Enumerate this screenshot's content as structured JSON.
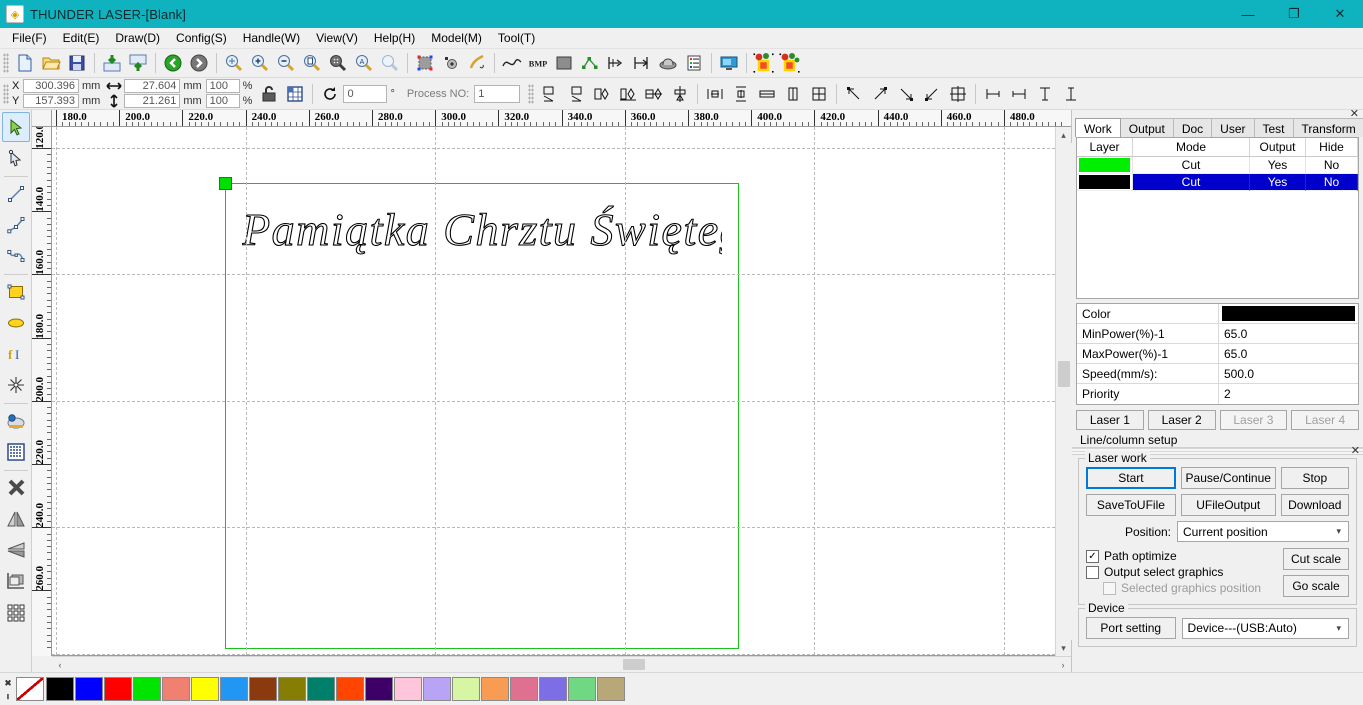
{
  "window": {
    "title": "THUNDER LASER-[Blank]",
    "app_icon": "app-logo-icon",
    "minimize": "—",
    "restore": "❐",
    "close": "✕"
  },
  "menubar": {
    "items": [
      {
        "label": "File(F)"
      },
      {
        "label": "Edit(E)"
      },
      {
        "label": "Draw(D)"
      },
      {
        "label": "Config(S)"
      },
      {
        "label": "Handle(W)"
      },
      {
        "label": "View(V)"
      },
      {
        "label": "Help(H)"
      },
      {
        "label": "Model(M)"
      },
      {
        "label": "Tool(T)"
      }
    ]
  },
  "toolbar_main": {
    "groups": [
      {
        "icons": [
          {
            "name": "new-file-icon",
            "title": "New"
          },
          {
            "name": "open-file-icon",
            "title": "Open"
          },
          {
            "name": "save-file-icon",
            "title": "Save"
          }
        ]
      },
      {
        "icons": [
          {
            "name": "import-image-icon",
            "title": "Import"
          },
          {
            "name": "export-image-icon",
            "title": "Export"
          }
        ]
      },
      {
        "icons": [
          {
            "name": "undo-icon",
            "title": "Undo"
          },
          {
            "name": "redo-icon",
            "title": "Redo"
          }
        ]
      },
      {
        "icons": [
          {
            "name": "zoom-pan-icon",
            "title": "Pan"
          },
          {
            "name": "zoom-in-icon",
            "title": "Zoom In"
          },
          {
            "name": "zoom-out-icon",
            "title": "Zoom Out"
          },
          {
            "name": "zoom-page-icon",
            "title": "Fit Page"
          },
          {
            "name": "zoom-selection-icon",
            "title": "Zoom Selection"
          },
          {
            "name": "zoom-all-icon",
            "title": "Zoom All"
          },
          {
            "name": "zoom-window-icon",
            "title": "Zoom Window"
          }
        ]
      },
      {
        "icons": [
          {
            "name": "bounding-box-icon",
            "title": "Bounds"
          },
          {
            "name": "node-edit-icon",
            "title": "Node Edit"
          },
          {
            "name": "curve-smooth-icon",
            "title": "Smooth"
          }
        ]
      },
      {
        "icons": [
          {
            "name": "curve-tool-icon",
            "title": "Curve"
          },
          {
            "name": "bmp-icon",
            "title": "BMP"
          },
          {
            "name": "fill-icon",
            "title": "Fill"
          },
          {
            "name": "path-nodes-icon",
            "title": "Path Nodes"
          },
          {
            "name": "offset-icon",
            "title": "Offset"
          },
          {
            "name": "measure-icon",
            "title": "Measure"
          },
          {
            "name": "array-icon",
            "title": "Array"
          },
          {
            "name": "list-settings-icon",
            "title": "List"
          }
        ]
      },
      {
        "icons": [
          {
            "name": "preview-monitor-icon",
            "title": "Preview"
          }
        ]
      },
      {
        "icons": [
          {
            "name": "cut-group-icon",
            "title": "Group"
          },
          {
            "name": "cut-ungroup-icon",
            "title": "Ungroup"
          }
        ]
      }
    ]
  },
  "toolbar_props": {
    "x_label": "X",
    "y_label": "Y",
    "x_value": "300.396",
    "y_value": "157.393",
    "width_value": "27.604",
    "height_value": "21.261",
    "unit": "mm",
    "scale_x": "100",
    "scale_y": "100",
    "percent": "%",
    "lock_icon": "lock-aspect-icon",
    "anchor_icon": "anchor-grid-icon",
    "rotate_icon": "rotate-icon",
    "rotate_value": "0",
    "degree": "°",
    "process_no_label": "Process NO:",
    "process_no_value": "1",
    "align_icons": [
      {
        "name": "mirror-horizontal-icon"
      },
      {
        "name": "mirror-vertical-icon"
      },
      {
        "name": "align-left-objects-icon"
      },
      {
        "name": "align-right-objects-icon"
      },
      {
        "name": "align-center-h-icon"
      },
      {
        "name": "align-center-v-icon"
      },
      {
        "name": "distribute-h-icon"
      },
      {
        "name": "distribute-v-icon"
      },
      {
        "name": "same-width-icon"
      },
      {
        "name": "same-height-icon"
      },
      {
        "name": "same-size-icon"
      },
      {
        "name": "align-topleft-icon"
      },
      {
        "name": "align-topright-icon"
      },
      {
        "name": "align-bottomright-icon"
      },
      {
        "name": "align-bottomleft-icon"
      },
      {
        "name": "align-center-icon"
      },
      {
        "name": "align-left-edge-icon"
      },
      {
        "name": "align-right-edge-icon"
      },
      {
        "name": "align-top-edge-icon"
      },
      {
        "name": "align-bottom-edge-icon"
      }
    ]
  },
  "left_tools": [
    {
      "name": "select-tool",
      "icon": "cursor-arrow-icon",
      "active": true
    },
    {
      "name": "node-edit-tool",
      "icon": "node-arrow-icon",
      "active": false
    },
    {
      "name": "line-tool",
      "icon": "line-icon",
      "active": false
    },
    {
      "name": "polyline-tool",
      "icon": "polyline-icon",
      "active": false
    },
    {
      "name": "bezier-tool",
      "icon": "bezier-curve-icon",
      "active": false
    },
    {
      "name": "rectangle-tool",
      "icon": "rectangle-icon",
      "active": false
    },
    {
      "name": "ellipse-tool",
      "icon": "ellipse-icon",
      "active": false
    },
    {
      "name": "text-tool",
      "icon": "text-icon",
      "active": false
    },
    {
      "name": "star-tool",
      "icon": "starburst-icon",
      "active": false
    },
    {
      "name": "capture-tool",
      "icon": "camera-icon",
      "active": false
    },
    {
      "name": "dot-matrix-tool",
      "icon": "dot-matrix-icon",
      "active": false
    },
    {
      "name": "delete-tool",
      "icon": "x-delete-icon",
      "active": false
    },
    {
      "name": "mirror-h-tool",
      "icon": "mirror-horizontal-icon",
      "active": false
    },
    {
      "name": "mirror-v-tool",
      "icon": "mirror-vertical-icon",
      "active": false
    },
    {
      "name": "origin-tool",
      "icon": "origin-corner-icon",
      "active": false
    },
    {
      "name": "grid-array-tool",
      "icon": "grid-array-icon",
      "active": false
    }
  ],
  "canvas": {
    "ruler_h_labels": [
      "180.0",
      "200.0",
      "220.0",
      "240.0",
      "260.0",
      "280.0",
      "300.0",
      "320.0",
      "340.0",
      "360.0",
      "380.0",
      "400.0",
      "420.0",
      "440.0",
      "460.0",
      "480.0"
    ],
    "ruler_v_labels": [
      "120.0",
      "140.0",
      "160.0",
      "180.0",
      "200.0",
      "220.0",
      "240.0",
      "260.0"
    ],
    "artwork_text": "Pamiątka Chrztu Świętego",
    "work_rect_color": "#16c316",
    "handle_color": "#00e000",
    "scroll_left_arrow": "‹",
    "scroll_right_arrow": "›",
    "scroll_up_arrow": "▴",
    "scroll_down_arrow": "▾"
  },
  "right_panel": {
    "close_icon": "✕",
    "tabs": [
      {
        "label": "Work",
        "active": true
      },
      {
        "label": "Output",
        "active": false
      },
      {
        "label": "Doc",
        "active": false
      },
      {
        "label": "User",
        "active": false
      },
      {
        "label": "Test",
        "active": false
      },
      {
        "label": "Transform",
        "active": false
      }
    ],
    "layer_table": {
      "headers": [
        "Layer",
        "Mode",
        "Output",
        "Hide"
      ],
      "rows": [
        {
          "color": "#00ee00",
          "mode": "Cut",
          "output": "Yes",
          "hide": "No",
          "selected": false
        },
        {
          "color": "#000000",
          "mode": "Cut",
          "output": "Yes",
          "hide": "No",
          "selected": true
        }
      ]
    },
    "properties": [
      {
        "key": "Color",
        "value": "",
        "color": "#000000"
      },
      {
        "key": "MinPower(%)-1",
        "value": "65.0"
      },
      {
        "key": "MaxPower(%)-1",
        "value": "65.0"
      },
      {
        "key": "Speed(mm/s):",
        "value": "500.0"
      },
      {
        "key": "Priority",
        "value": "2"
      }
    ],
    "laser_buttons": [
      {
        "label": "Laser 1",
        "disabled": false
      },
      {
        "label": "Laser 2",
        "disabled": false
      },
      {
        "label": "Laser 3",
        "disabled": true
      },
      {
        "label": "Laser 4",
        "disabled": true
      }
    ],
    "line_column_setup": "Line/column setup",
    "laser_work": {
      "title": "Laser work",
      "start": "Start",
      "pause_continue": "Pause/Continue",
      "stop": "Stop",
      "save_to_ufile": "SaveToUFile",
      "ufile_output": "UFileOutput",
      "download": "Download",
      "position_label": "Position:",
      "position_value": "Current position",
      "path_optimize": "Path optimize",
      "path_optimize_checked": true,
      "output_select_graphics": "Output select graphics",
      "output_select_checked": false,
      "selected_graphics_position": "Selected graphics position",
      "selected_graphics_checked": false,
      "cut_scale": "Cut scale",
      "go_scale": "Go scale"
    },
    "device": {
      "title": "Device",
      "port_setting": "Port setting",
      "device_value": "Device---(USB:Auto)"
    }
  },
  "palette": {
    "grip_icon": "✖",
    "none_swatch": "no-color-swatch",
    "colors": [
      "#000000",
      "#0000ff",
      "#ff0000",
      "#00e500",
      "#f08070",
      "#ffff00",
      "#2196f3",
      "#8b3a0f",
      "#867d05",
      "#00806a",
      "#ff4500",
      "#3d0066",
      "#ffc5da",
      "#b9a3f5",
      "#d6f6a3",
      "#f79c52",
      "#e0708f",
      "#7e6ee6",
      "#70d882",
      "#b9a877"
    ]
  }
}
